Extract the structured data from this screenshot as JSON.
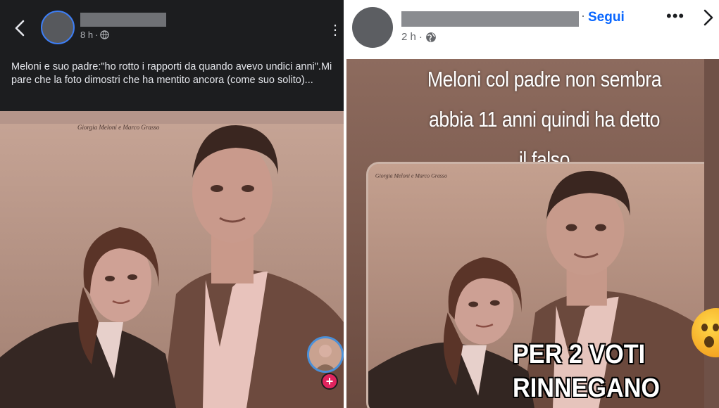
{
  "left_post": {
    "time": "8 h",
    "visibility_icon": "globe-icon",
    "caption": "Meloni e suo padre:\"ho rotto i rapporti da quando avevo undici anni\".Mi pare che la foto dimostri che ha mentito ancora (come suo solito)...",
    "more_label": "⋮",
    "photo_caption": "Giorgia Meloni e Marco Grasso",
    "reel_plus": "+"
  },
  "right_post": {
    "follow_label": "Segui",
    "time": "2 h",
    "visibility_icon": "globe-icon",
    "more_label": "•••",
    "overlay_lines": [
      "Meloni col padre non sembra",
      "abbia 11 anni quindi ha detto",
      "il falso"
    ],
    "photo_caption": "Giorgia Meloni e Marco Grasso",
    "banner_lines": [
      "PER 2 VOTI",
      "RINNEGANO"
    ]
  },
  "colors": {
    "dark_bg": "#1c1d1f",
    "facebook_blue": "#0866ff",
    "dark_text": "#e4e6eb",
    "muted_text": "#b0b3b8"
  }
}
